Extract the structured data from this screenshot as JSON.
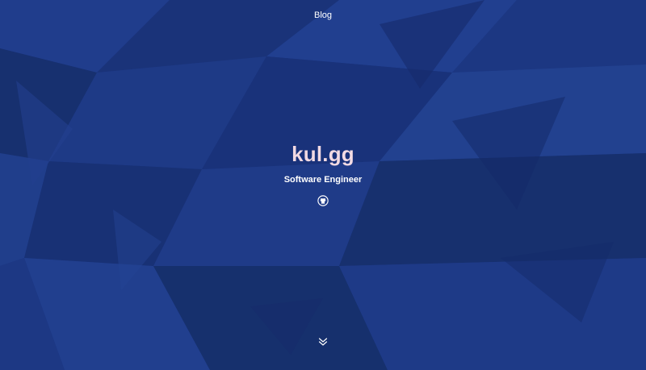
{
  "nav": {
    "blog_label": "Blog"
  },
  "hero": {
    "title": "kul.gg",
    "subtitle": "Software Engineer"
  },
  "icons": {
    "social": "github-icon",
    "scroll": "chevron-double-down-icon"
  },
  "colors": {
    "background": "#1b3580",
    "title_gradient_start": "#e9c8d8",
    "title_gradient_end": "#f6e3c9",
    "text": "#ffffff"
  }
}
